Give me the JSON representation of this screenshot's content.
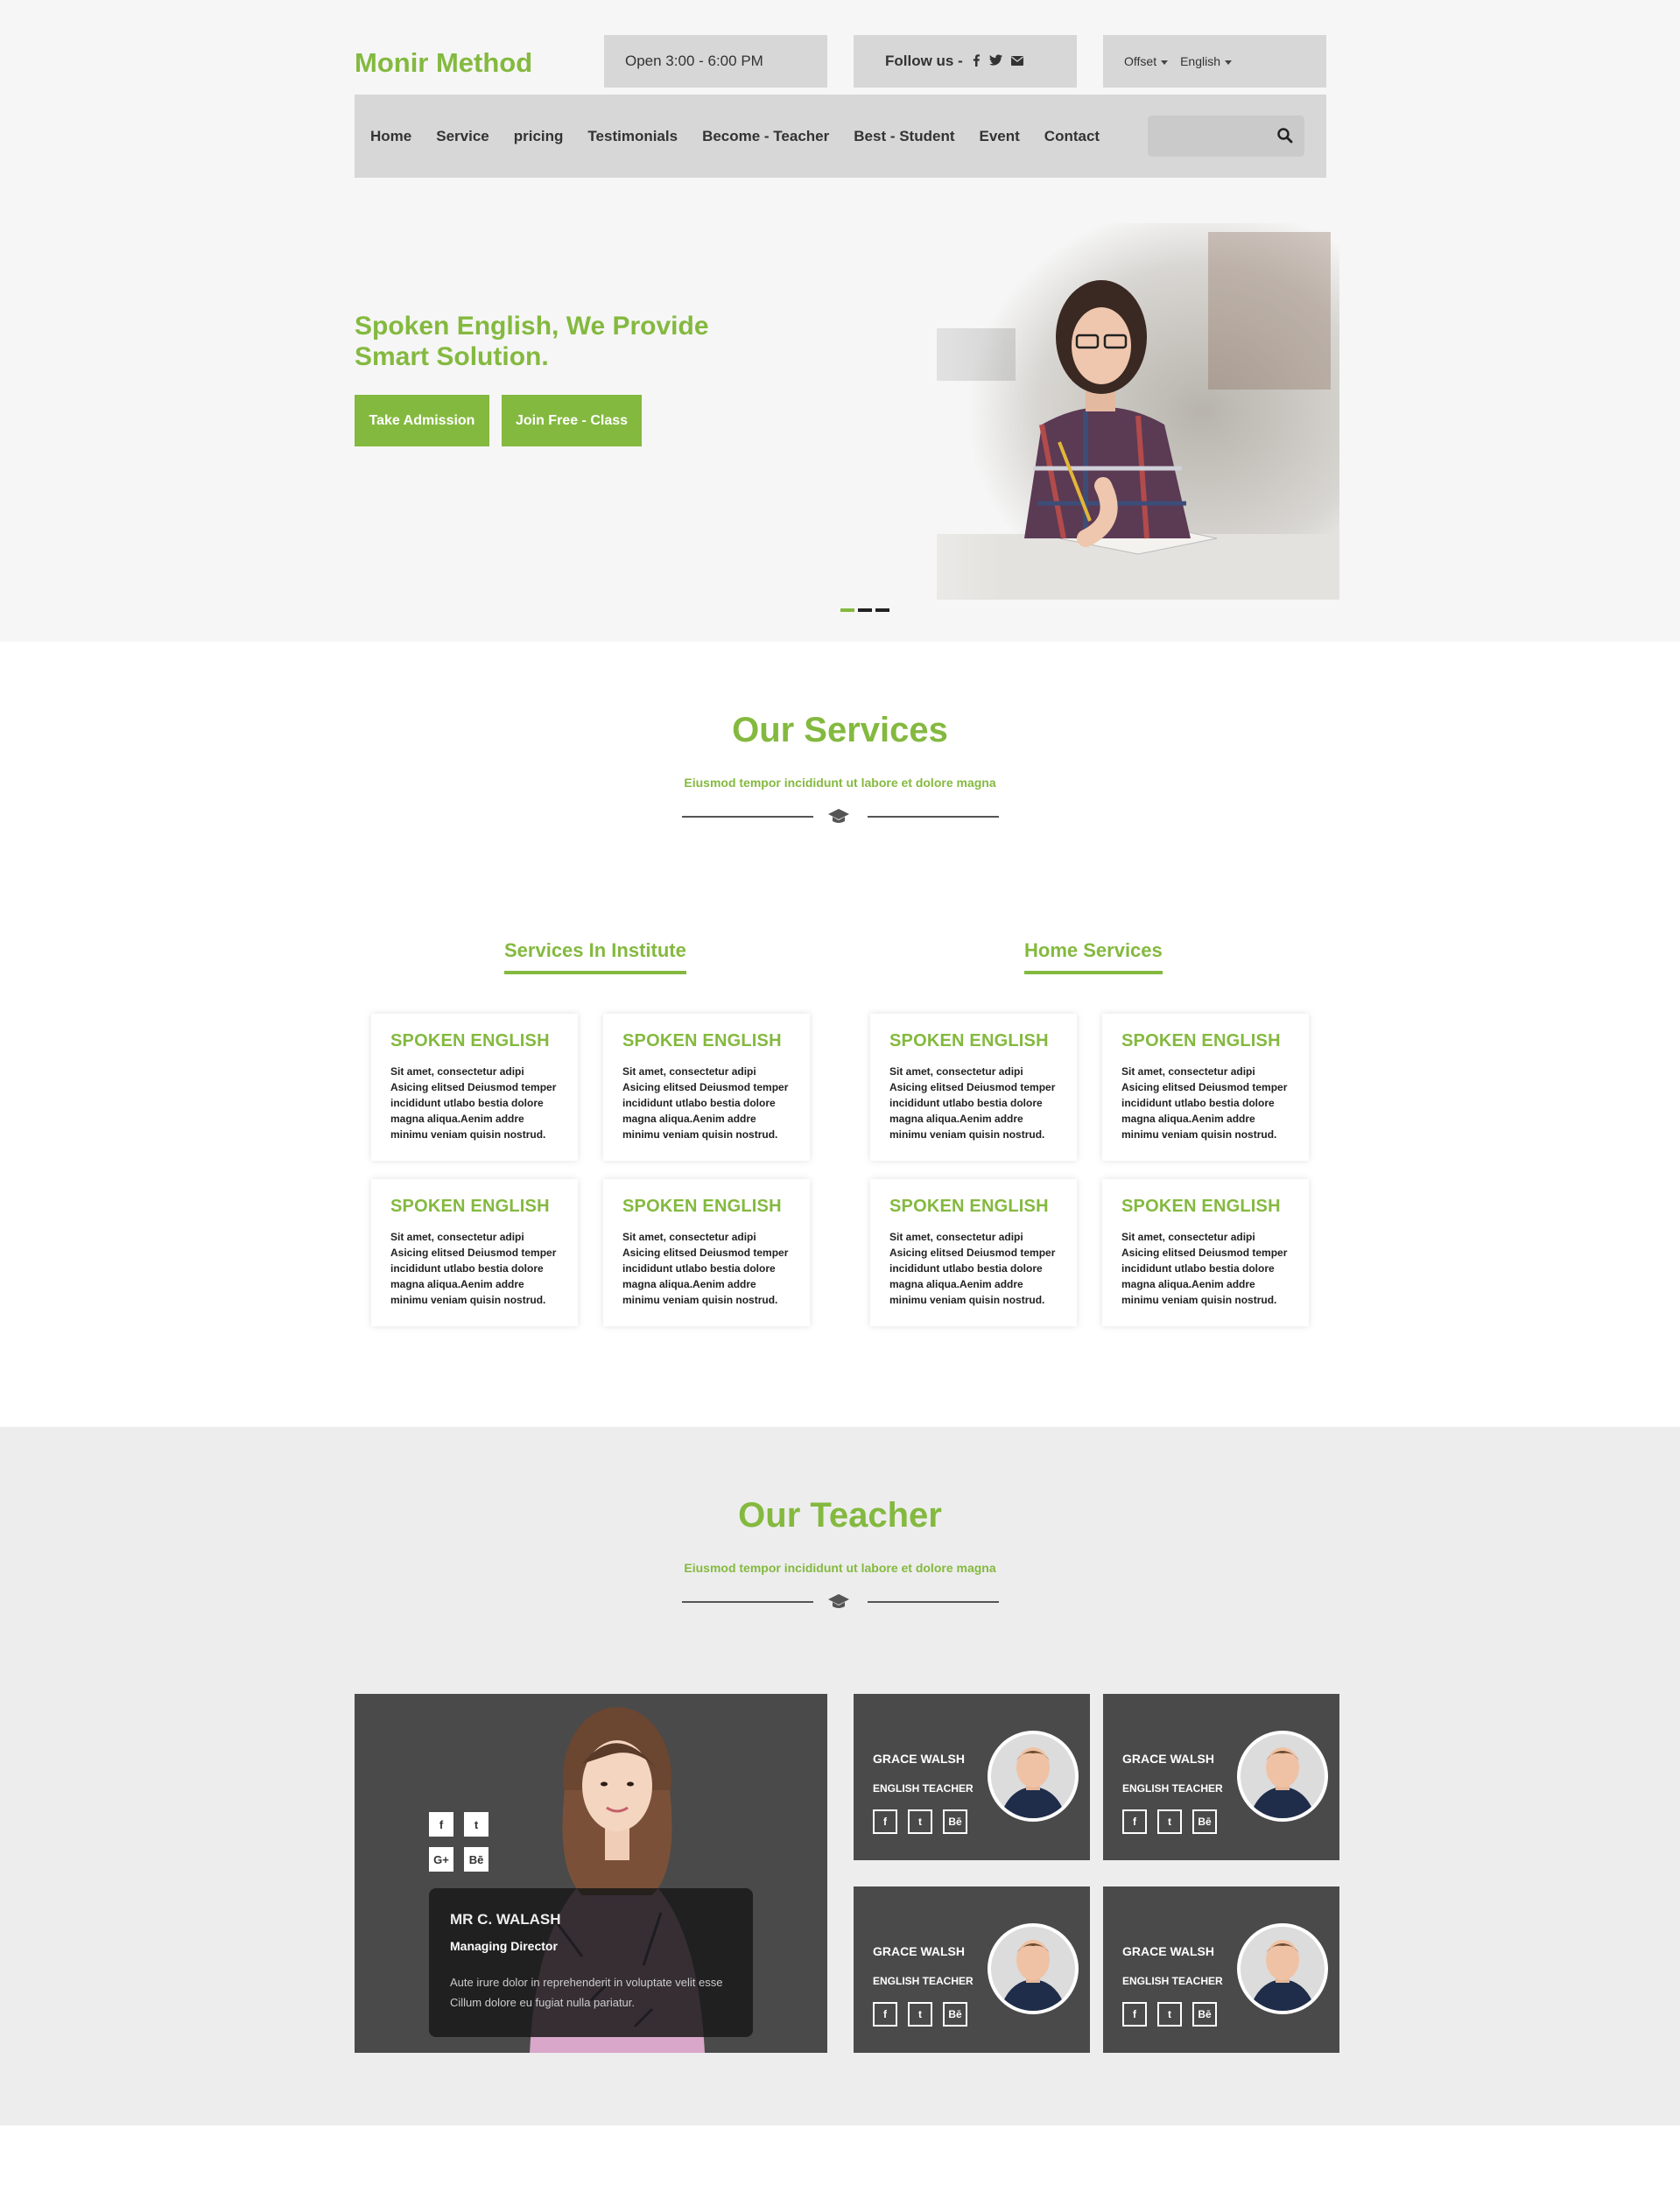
{
  "header": {
    "logo": "Monir Method",
    "hours": "Open 3:00 - 6:00 PM",
    "follow_label": "Follow us -",
    "offset_label": "Offset",
    "language": "English"
  },
  "nav": {
    "items": [
      "Home",
      "Service",
      "pricing",
      "Testimonials",
      "Become - Teacher",
      "Best - Student",
      "Event",
      "Contact"
    ],
    "search_placeholder": ""
  },
  "hero": {
    "title_line1": "Spoken English, We Provide",
    "title_line2": "Smart Solution.",
    "button_admission": "Take Admission",
    "button_join": "Join Free - Class",
    "slides": 3,
    "active_slide": 1
  },
  "services": {
    "title": "Our Services",
    "subtitle": "Eiusmod tempor incididunt ut labore et dolore magna",
    "institute_heading": "Services In Institute",
    "home_heading": "Home Services",
    "cards": [
      {
        "title": "SPOKEN ENGLISH",
        "text": "Sit amet, consectetur adipi Asicing elitsed Deiusmod temper incididunt utlabo bestia dolore magna aliqua.Aenim addre minimu veniam quisin nostrud."
      },
      {
        "title": "SPOKEN ENGLISH",
        "text": "Sit amet, consectetur adipi Asicing elitsed Deiusmod temper incididunt utlabo bestia dolore magna aliqua.Aenim addre minimu veniam quisin nostrud."
      },
      {
        "title": "SPOKEN ENGLISH",
        "text": "Sit amet, consectetur adipi Asicing elitsed Deiusmod temper incididunt utlabo bestia dolore magna aliqua.Aenim addre minimu veniam quisin nostrud."
      },
      {
        "title": "SPOKEN ENGLISH",
        "text": "Sit amet, consectetur adipi Asicing elitsed Deiusmod temper incididunt utlabo bestia dolore magna aliqua.Aenim addre minimu veniam quisin nostrud."
      },
      {
        "title": "SPOKEN ENGLISH",
        "text": "Sit amet, consectetur adipi Asicing elitsed Deiusmod temper incididunt utlabo bestia dolore magna aliqua.Aenim addre minimu veniam quisin nostrud."
      },
      {
        "title": "SPOKEN ENGLISH",
        "text": "Sit amet, consectetur adipi Asicing elitsed Deiusmod temper incididunt utlabo bestia dolore magna aliqua.Aenim addre minimu veniam quisin nostrud."
      },
      {
        "title": "SPOKEN ENGLISH",
        "text": "Sit amet, consectetur adipi Asicing elitsed Deiusmod temper incididunt utlabo bestia dolore magna aliqua.Aenim addre minimu veniam quisin nostrud."
      },
      {
        "title": "SPOKEN ENGLISH",
        "text": "Sit amet, consectetur adipi Asicing elitsed Deiusmod temper incididunt utlabo bestia dolore magna aliqua.Aenim addre minimu veniam quisin nostrud."
      }
    ]
  },
  "teachers": {
    "title": "Our Teacher",
    "subtitle": "Eiusmod tempor incididunt ut labore et dolore magna",
    "featured": {
      "name": "MR C. WALASH",
      "role": "Managing Director",
      "desc_line1": "Aute irure dolor in reprehenderit in voluptate velit esse",
      "desc_line2": "Cillum dolore eu fugiat nulla pariatur.",
      "social": [
        "f",
        "t",
        "G+",
        "Bē"
      ]
    },
    "cards": [
      {
        "name": "GRACE WALSH",
        "role": "ENGLISH TEACHER"
      },
      {
        "name": "GRACE WALSH",
        "role": "ENGLISH TEACHER"
      },
      {
        "name": "GRACE WALSH",
        "role": "ENGLISH TEACHER"
      },
      {
        "name": "GRACE WALSH",
        "role": "ENGLISH TEACHER"
      }
    ],
    "card_social": [
      "f",
      "t",
      "Bē"
    ]
  },
  "colors": {
    "accent": "#84b93f",
    "dark_card": "#4a4a4a",
    "header_box": "#d7d7d7"
  },
  "icons": [
    "facebook-icon",
    "twitter-icon",
    "mail-icon",
    "search-icon",
    "graduation-cap-icon",
    "google-plus-icon",
    "behance-icon"
  ]
}
